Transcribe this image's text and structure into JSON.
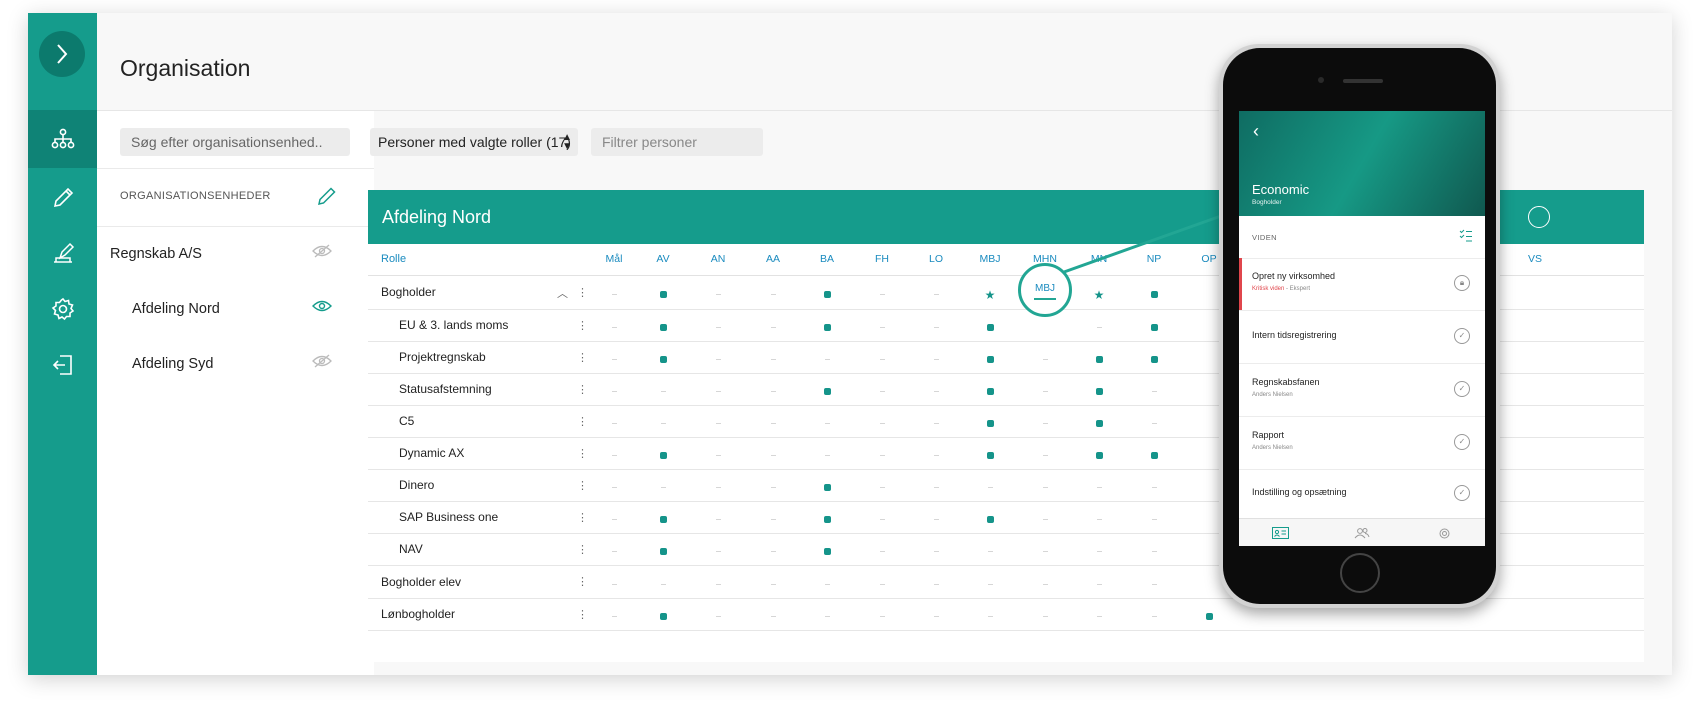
{
  "header": {
    "title": "Organisation"
  },
  "sidebar": {
    "toggle_icon": "chevron-right-icon",
    "items": [
      {
        "name": "org-tree-icon"
      },
      {
        "name": "pencil-icon"
      },
      {
        "name": "approval-icon"
      },
      {
        "name": "gear-icon"
      },
      {
        "name": "logout-icon"
      }
    ]
  },
  "org_panel": {
    "search_placeholder": "Søg efter organisationsenhed..",
    "section_label": "ORGANISATIONSENHEDER",
    "units": [
      {
        "label": "Regnskab A/S",
        "visible": false
      },
      {
        "label": "Afdeling Nord",
        "visible": true
      },
      {
        "label": "Afdeling Syd",
        "visible": false
      }
    ]
  },
  "toolbar": {
    "role_select": "Personer med valgte roller (17)",
    "filter_placeholder": "Filtrer personer"
  },
  "matrix": {
    "title": "Afdeling Nord",
    "role_header": "Rolle",
    "columns": [
      "Mål",
      "AV",
      "AN",
      "AA",
      "BA",
      "FH",
      "LO",
      "MBJ",
      "MHN",
      "MN",
      "NP",
      "OP",
      "VS"
    ],
    "rows": [
      {
        "label": "Bogholder",
        "indent": 0,
        "expanded": true,
        "cells": [
          "-",
          "d",
          "-",
          "-",
          "d",
          "-",
          "-",
          "s",
          "",
          "s",
          "d",
          "",
          ""
        ]
      },
      {
        "label": "EU & 3. lands moms",
        "indent": 1,
        "cells": [
          "-",
          "d",
          "-",
          "-",
          "d",
          "-",
          "-",
          "d",
          "",
          "-",
          "d",
          "",
          ""
        ]
      },
      {
        "label": "Projektregnskab",
        "indent": 1,
        "cells": [
          "-",
          "d",
          "-",
          "-",
          "-",
          "-",
          "-",
          "d",
          "-",
          "d",
          "d",
          "",
          ""
        ]
      },
      {
        "label": "Statusafstemning",
        "indent": 1,
        "cells": [
          "-",
          "-",
          "-",
          "-",
          "d",
          "-",
          "-",
          "d",
          "-",
          "d",
          "-",
          "",
          ""
        ]
      },
      {
        "label": "C5",
        "indent": 1,
        "cells": [
          "-",
          "-",
          "-",
          "-",
          "-",
          "-",
          "-",
          "d",
          "-",
          "d",
          "-",
          "",
          ""
        ]
      },
      {
        "label": "Dynamic AX",
        "indent": 1,
        "cells": [
          "-",
          "d",
          "-",
          "-",
          "-",
          "-",
          "-",
          "d",
          "-",
          "d",
          "d",
          "",
          ""
        ]
      },
      {
        "label": "Dinero",
        "indent": 1,
        "cells": [
          "-",
          "-",
          "-",
          "-",
          "d",
          "-",
          "-",
          "-",
          "-",
          "-",
          "-",
          "",
          ""
        ]
      },
      {
        "label": "SAP Business one",
        "indent": 1,
        "cells": [
          "-",
          "d",
          "-",
          "-",
          "d",
          "-",
          "-",
          "d",
          "-",
          "-",
          "-",
          "",
          ""
        ]
      },
      {
        "label": "NAV",
        "indent": 1,
        "cells": [
          "-",
          "d",
          "-",
          "-",
          "d",
          "-",
          "-",
          "-",
          "-",
          "-",
          "-",
          "",
          ""
        ]
      },
      {
        "label": "Bogholder elev",
        "indent": 0,
        "cells": [
          "-",
          "-",
          "-",
          "-",
          "-",
          "-",
          "-",
          "-",
          "-",
          "-",
          "-",
          "",
          ""
        ]
      },
      {
        "label": "Lønbogholder",
        "indent": 0,
        "cells": [
          "-",
          "d",
          "-",
          "-",
          "-",
          "-",
          "-",
          "-",
          "-",
          "-",
          "-",
          "d",
          ""
        ]
      }
    ],
    "highlight_label": "MBJ",
    "accent_color": "#159c8c"
  },
  "phone": {
    "app_title": "Economic",
    "app_subtitle": "Bogholder",
    "section_label": "VIDEN",
    "items": [
      {
        "title": "Opret ny virksomhed",
        "critical": "Kritisk viden",
        "sub": " - Ekspert",
        "state": "locked"
      },
      {
        "title": "Intern tidsregistrering",
        "sub": "",
        "state": "done"
      },
      {
        "title": "Regnskabsfanen",
        "sub": "Anders Nielsen",
        "state": "done"
      },
      {
        "title": "Rapport",
        "sub": "Anders Nielsen",
        "state": "done"
      },
      {
        "title": "Indstilling og opsætning",
        "sub": "",
        "state": "done"
      }
    ],
    "tabs": [
      "profile-card-icon",
      "people-icon",
      "gear-icon"
    ]
  }
}
